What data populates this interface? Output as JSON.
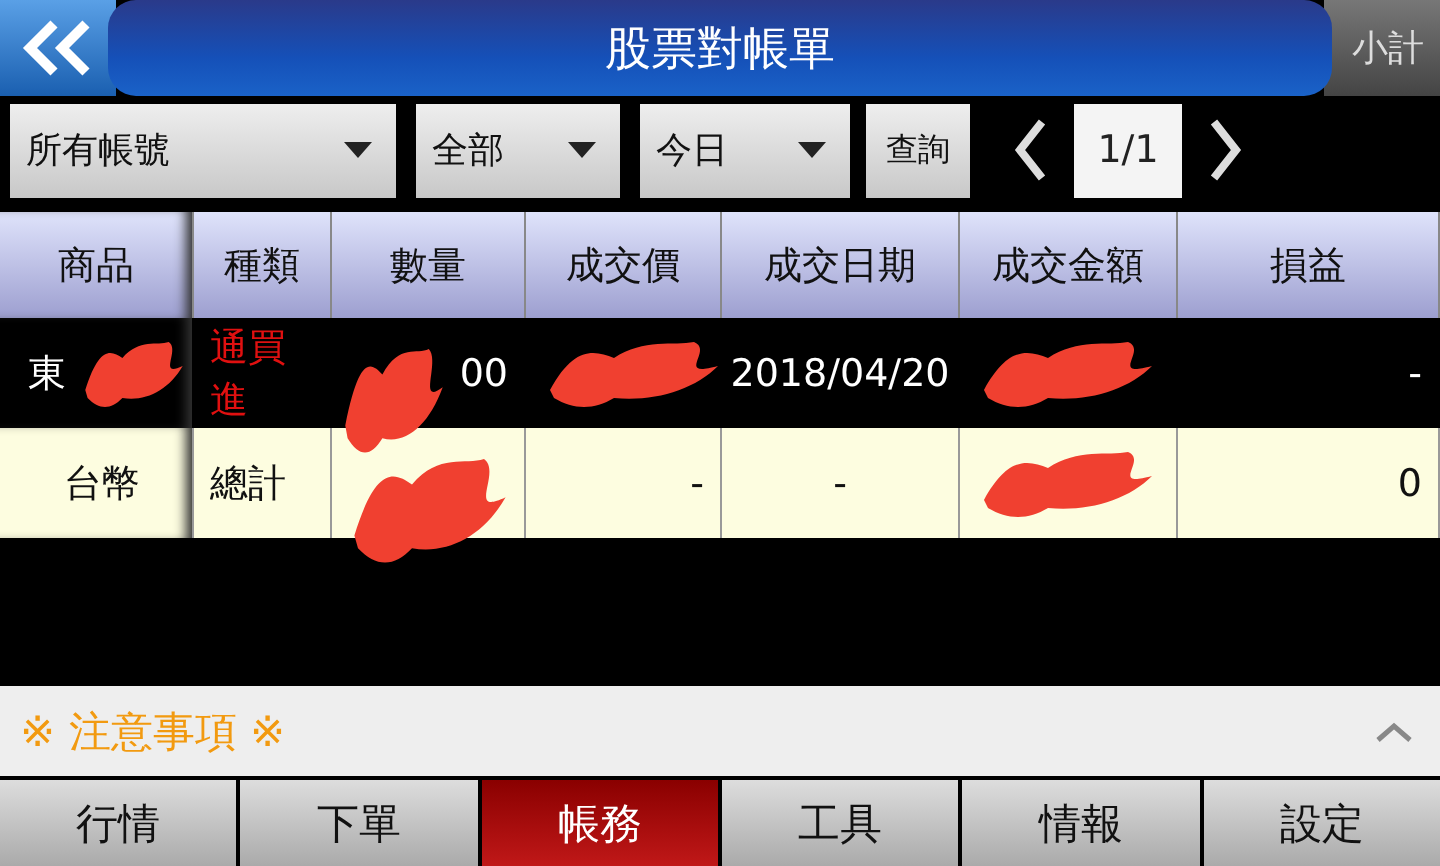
{
  "header": {
    "title": "股票對帳單",
    "subtotal_button": "小計"
  },
  "filters": [
    {
      "kind": "dropdown",
      "value": "所有帳號"
    },
    {
      "kind": "dropdown",
      "value": "全部"
    },
    {
      "kind": "dropdown",
      "value": "今日"
    },
    {
      "kind": "button",
      "value": "查詢"
    }
  ],
  "pager": {
    "page": "1/1"
  },
  "table": {
    "columns": [
      "商品",
      "種類",
      "數量",
      "成交價",
      "成交日期",
      "成交金額",
      "損益"
    ],
    "rows": [
      {
        "kind": "trade",
        "cells": [
          {
            "text": "東",
            "redacted": true
          },
          {
            "text": "通買進",
            "redacted": false
          },
          {
            "text": "00",
            "redacted": true
          },
          {
            "text": "",
            "redacted": true
          },
          {
            "text": "2018/04/20",
            "redacted": false
          },
          {
            "text": "",
            "redacted": true
          },
          {
            "text": "-",
            "redacted": false
          }
        ]
      },
      {
        "kind": "total",
        "cells": [
          {
            "text": "台幣",
            "redacted": false
          },
          {
            "text": "總計",
            "redacted": false
          },
          {
            "text": "",
            "redacted": true
          },
          {
            "text": "-",
            "redacted": false
          },
          {
            "text": "-",
            "redacted": false
          },
          {
            "text": "",
            "redacted": true
          },
          {
            "text": "0",
            "redacted": false
          }
        ]
      }
    ]
  },
  "notice": {
    "title": "※ 注意事項 ※"
  },
  "nav": [
    {
      "label": "行情",
      "selected": false
    },
    {
      "label": "下單",
      "selected": false
    },
    {
      "label": "帳務",
      "selected": true
    },
    {
      "label": "工具",
      "selected": false
    },
    {
      "label": "情報",
      "selected": false
    },
    {
      "label": "設定",
      "selected": false
    }
  ]
}
